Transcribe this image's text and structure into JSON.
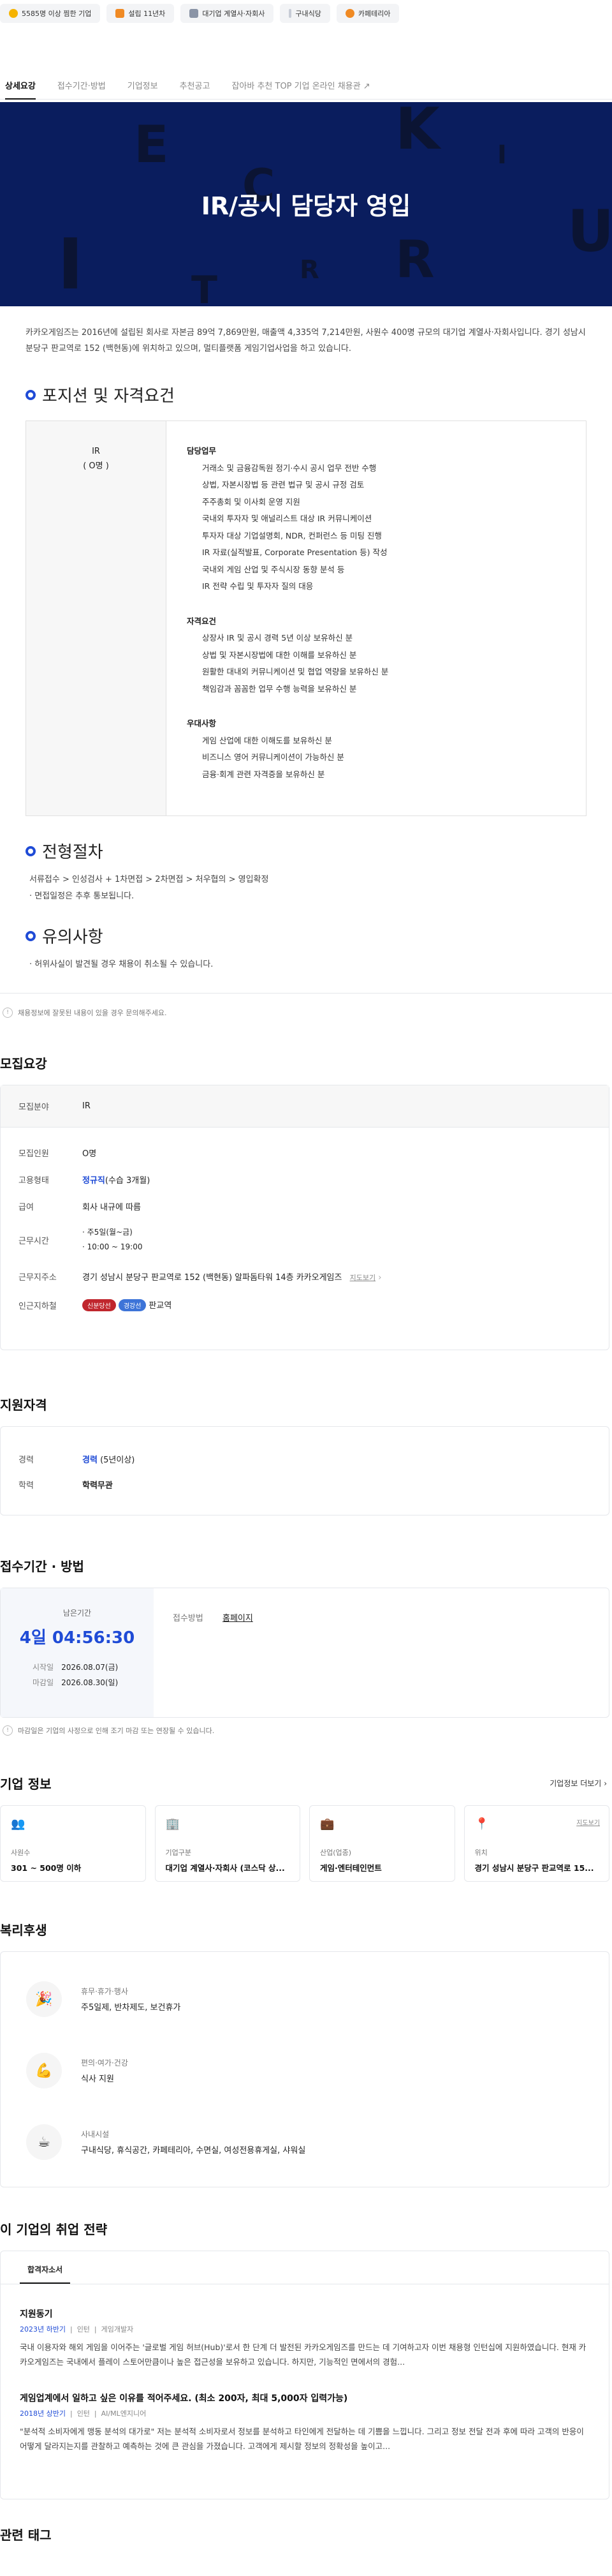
{
  "chips": [
    {
      "label": "5585명 이상 찜한 기업",
      "icon": "star-icon",
      "color": "#f5b301"
    },
    {
      "label": "설립 11년차",
      "icon": "flag-icon",
      "color": "#f08a24"
    },
    {
      "label": "대기업 계열사·자회사",
      "icon": "building-icon",
      "color": "#8a94a6"
    },
    {
      "label": "구내식당",
      "icon": "utensils-icon",
      "color": "#c7ccd6"
    },
    {
      "label": "카페테리아",
      "icon": "coffee-icon",
      "color": "#f08a24"
    }
  ],
  "tabs": [
    "상세요강",
    "접수기간·방법",
    "기업정보",
    "추천공고",
    "잡아바 추천 TOP 기업 온라인 채용관"
  ],
  "banner": {
    "title": "IR/공시 담당자 영입",
    "bg_letters": [
      "E",
      "K",
      "I",
      "C",
      "R",
      "U",
      "I",
      "T",
      "R"
    ]
  },
  "intro": "카카오게임즈는 2016년에 설립된 회사로 자본금 89억 7,869만원, 매출액 4,335억 7,214만원, 사원수 400명 규모의 대기업 계열사·자회사입니다. 경기 성남시 분당구 판교역로 152 (백현동)에 위치하고 있으며, 멀티플랫폼 게임기업사업을 하고 있습니다.",
  "position_section": {
    "heading": "포지션 및 자격요건",
    "role": "IR",
    "headcount": "( O명 )",
    "groups": [
      {
        "title": "담당업무",
        "items": [
          "거래소 및 금융감독원 정기·수시 공시 업무 전반 수행",
          "상법, 자본시장법 등 관련 법규 및 공시 규정 검토",
          "주주총회 및 이사회 운영 지원",
          "국내외 투자자 및 애널리스트 대상 IR 커뮤니케이션",
          "투자자 대상 기업설명회, NDR, 컨퍼런스 등 미팅 진행",
          "IR 자료(실적발표, Corporate Presentation 등) 작성",
          "국내외 게임 산업 및 주식시장 동향 분석 등",
          "IR 전략 수립 및 투자자 질의 대응"
        ]
      },
      {
        "title": "자격요건",
        "items": [
          "상장사 IR 및 공시 경력 5년 이상 보유하신 분",
          "상법 및 자본시장법에 대한 이해를 보유하신 분",
          "원활한 대내외 커뮤니케이션 및 협업 역량을 보유하신 분",
          "책임감과 꼼꼼한 업무 수행 능력을 보유하신 분"
        ]
      },
      {
        "title": "우대사항",
        "items": [
          "게임 산업에 대한 이해도를 보유하신 분",
          "비즈니스 영어 커뮤니케이션이 가능하신 분",
          "금융·회계 관련 자격증을 보유하신 분"
        ]
      }
    ]
  },
  "process_section": {
    "heading": "전형절차",
    "steps": "서류접수 > 인성검사 + 1차면접 > 2차면접 > 처우협의 > 영입확정",
    "note": "· 면접일정은 추후 통보됩니다."
  },
  "caution_section": {
    "heading": "유의사항",
    "note": "· 허위사실이 발견될 경우 채용이 취소될 수 있습니다."
  },
  "notice_text": "채용정보에 잘못된 내용이 있을 경우 문의해주세요.",
  "recruit": {
    "heading": "모집요강",
    "field_label": "모집분야",
    "field_value": "IR",
    "rows": [
      {
        "k": "모집인원",
        "v": "O명"
      },
      {
        "k": "고용형태",
        "v": "정규직",
        "v2": "(수습 3개월)"
      },
      {
        "k": "급여",
        "v": "회사 내규에 따름"
      }
    ],
    "hours_label": "근무시간",
    "hours": [
      "주5일(월~금)",
      "10:00 ~ 19:00"
    ],
    "address_label": "근무지주소",
    "address": "경기 성남시 분당구 판교역로 152 (백현동) 알파돔타워 14층 카카오게임즈",
    "map_link": "지도보기",
    "subway_label": "인근지하철",
    "subway_badges": [
      {
        "t": "신분당선",
        "c": "#c0262d"
      },
      {
        "t": "경강선",
        "c": "#3d74d8"
      }
    ],
    "subway_station": "판교역"
  },
  "qualify": {
    "heading": "지원자격",
    "career_label": "경력",
    "career_value": "경력",
    "career_sub": "(5년이상)",
    "edu_label": "학력",
    "edu_value": "학력무관"
  },
  "apply": {
    "heading": "접수기간 · 방법",
    "remain_label": "남은기간",
    "remain": "4일 04:56:30",
    "start_label": "시작일",
    "start": "2026.08.07(금)",
    "end_label": "마감일",
    "end": "2026.08.30(일)",
    "method_label": "접수방법",
    "method": "홈페이지",
    "note": "마감일은 기업의 사정으로 인해 조기 마감 또는 연장될 수 있습니다."
  },
  "company": {
    "heading": "기업 정보",
    "more": "기업정보 더보기",
    "cards": [
      {
        "icon": "people-icon",
        "label": "사원수",
        "value": "301 ~ 500명 이하"
      },
      {
        "icon": "building-icon",
        "label": "기업구분",
        "value": "대기업 계열사·자회사 (코스닥 상..."
      },
      {
        "icon": "briefcase-icon",
        "label": "산업(업종)",
        "value": "게임·엔터테인먼트"
      },
      {
        "icon": "pin-icon",
        "label": "위치",
        "value": "경기 성남시 분당구 판교역로 15...",
        "link": "지도보기"
      }
    ]
  },
  "welfare": {
    "heading": "복리후생",
    "items": [
      {
        "icon": "party-icon",
        "glyph": "🎉",
        "title": "휴무·휴가·행사",
        "desc": "주5일제, 반차제도, 보건휴가"
      },
      {
        "icon": "muscle-icon",
        "glyph": "💪",
        "title": "편의·여가·건강",
        "desc": "식사 지원"
      },
      {
        "icon": "coffee-cup-icon",
        "glyph": "☕",
        "title": "사내시설",
        "desc": "구내식당, 휴식공간, 카페테리아, 수면실, 여성전용휴게실, 샤워실"
      }
    ]
  },
  "strategy": {
    "heading": "이 기업의 취업 전략",
    "tab": "합격자소서",
    "items": [
      {
        "title": "지원동기",
        "year": "2023년 하반기",
        "type": "인턴",
        "job": "게임개발자",
        "body": "국내 이용자와 해외 게임을 이어주는 '글로벌 게임 허브(Hub)'로서 한 단계 더 발전된 카카오게임즈를 만드는 데 기여하고자 이번 채용형 인턴십에 지원하였습니다. 현재 카카오게임즈는 국내에서 플레이 스토어만큼이나 높은 접근성을 보유하고 있습니다. 하지만, 기능적인 면에서의 경험..."
      },
      {
        "title": "게임업계에서 일하고 싶은 이유를 적어주세요. (최소 200자, 최대 5,000자 입력가능)",
        "year": "2018년 상반기",
        "type": "인턴",
        "job": "AI/ML엔지니어",
        "body": "\"분석적 소비자에게 맹동 분석의 대가로\" 저는 분석적 소비자로서 정보를 분석하고 타인에게 전달하는 데 기쁨을 느낍니다. 그리고 정보 전달 전과 후에 따라 고객의 반응이 어떻게 달라지는지를 관찰하고 예측하는 것에 큰 관심을 가졌습니다. 고객에게 제시할 정보의 정확성을 높이고..."
      }
    ]
  },
  "tags_heading": "관련 태그"
}
